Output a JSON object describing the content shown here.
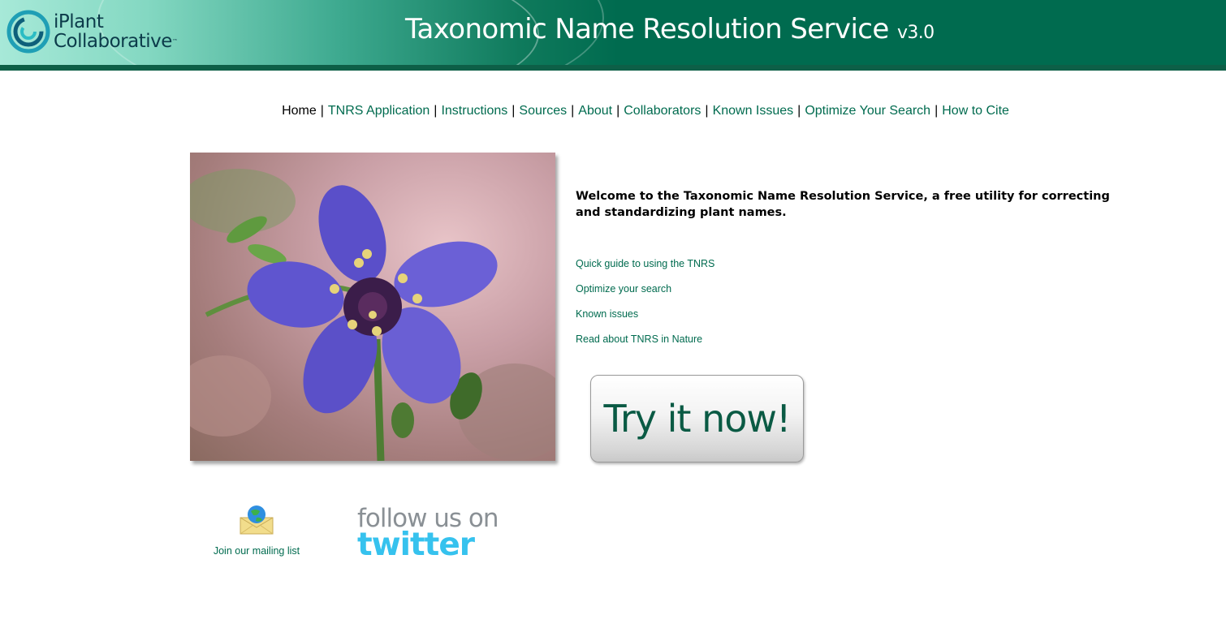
{
  "header": {
    "logo_line1": "iPlant",
    "logo_line2": "Collaborative",
    "logo_tm": "™",
    "title": "Taxonomic Name Resolution Service",
    "version": "v3.0"
  },
  "nav": {
    "items": [
      {
        "label": "Home"
      },
      {
        "label": "TNRS Application"
      },
      {
        "label": "Instructions"
      },
      {
        "label": "Sources"
      },
      {
        "label": "About"
      },
      {
        "label": "Collaborators"
      },
      {
        "label": "Known Issues"
      },
      {
        "label": "Optimize Your Search"
      },
      {
        "label": "How to Cite"
      }
    ],
    "separator": "|"
  },
  "main": {
    "welcome": "Welcome to the Taxonomic Name Resolution Service, a free utility for correcting and standardizing plant names.",
    "links": [
      {
        "label": "Quick guide to using the TNRS"
      },
      {
        "label": "Optimize your search"
      },
      {
        "label": "Known issues"
      },
      {
        "label": "Read about TNRS in Nature"
      }
    ],
    "try_button": "Try it now!"
  },
  "footer": {
    "mailing_label": "Join our mailing list",
    "follow_text": "follow us on",
    "twitter_text": "twitter"
  },
  "colors": {
    "brand_green": "#006b4f",
    "link_green": "#006b4f",
    "twitter_blue": "#36c2ee"
  },
  "icons": {
    "logo": "iplant-swirl-icon",
    "mail": "envelope-globe-icon"
  }
}
